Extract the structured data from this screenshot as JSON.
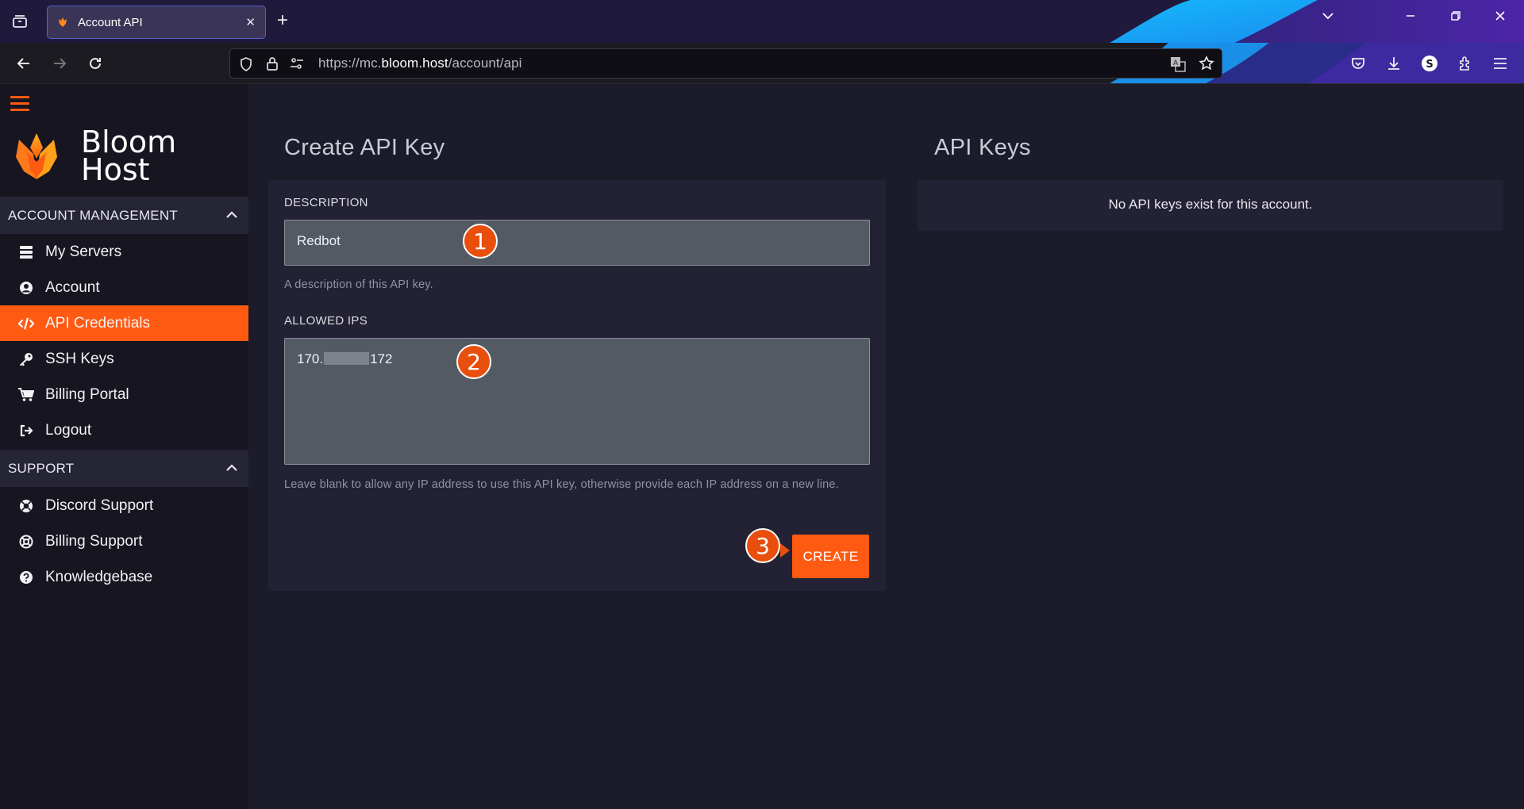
{
  "browser": {
    "tab_title": "Account API",
    "url_prefix": "https://mc.",
    "url_domain": "bloom.host",
    "url_path": "/account/api"
  },
  "sidebar": {
    "brand_line1": "Bloom",
    "brand_line2": "Host",
    "account_section": "ACCOUNT MANAGEMENT",
    "account_items": [
      {
        "label": "My Servers",
        "icon": "servers-icon"
      },
      {
        "label": "Account",
        "icon": "user-circle-icon"
      },
      {
        "label": "API Credentials",
        "icon": "code-icon"
      },
      {
        "label": "SSH Keys",
        "icon": "key-icon"
      },
      {
        "label": "Billing Portal",
        "icon": "cart-icon"
      },
      {
        "label": "Logout",
        "icon": "logout-icon"
      }
    ],
    "support_section": "SUPPORT",
    "support_items": [
      {
        "label": "Discord Support",
        "icon": "discord-icon"
      },
      {
        "label": "Billing Support",
        "icon": "lifebuoy-icon"
      },
      {
        "label": "Knowledgebase",
        "icon": "question-circle-icon"
      }
    ]
  },
  "create_key": {
    "title": "Create API Key",
    "description_label": "DESCRIPTION",
    "description_value": "Redbot",
    "description_help": "A description of this API key.",
    "ips_label": "ALLOWED IPS",
    "ips_value_start": "170.",
    "ips_value_end": "172",
    "ips_help": "Leave blank to allow any IP address to use this API key, otherwise provide each IP address on a new line.",
    "create_button": "CREATE"
  },
  "api_keys": {
    "title": "API Keys",
    "empty_message": "No API keys exist for this account."
  },
  "markers": [
    "1",
    "2",
    "3"
  ],
  "colors": {
    "accent": "#ff5a12",
    "sidebar_bg": "#161520",
    "main_bg": "#1c1b29",
    "panel_bg": "#232234"
  }
}
